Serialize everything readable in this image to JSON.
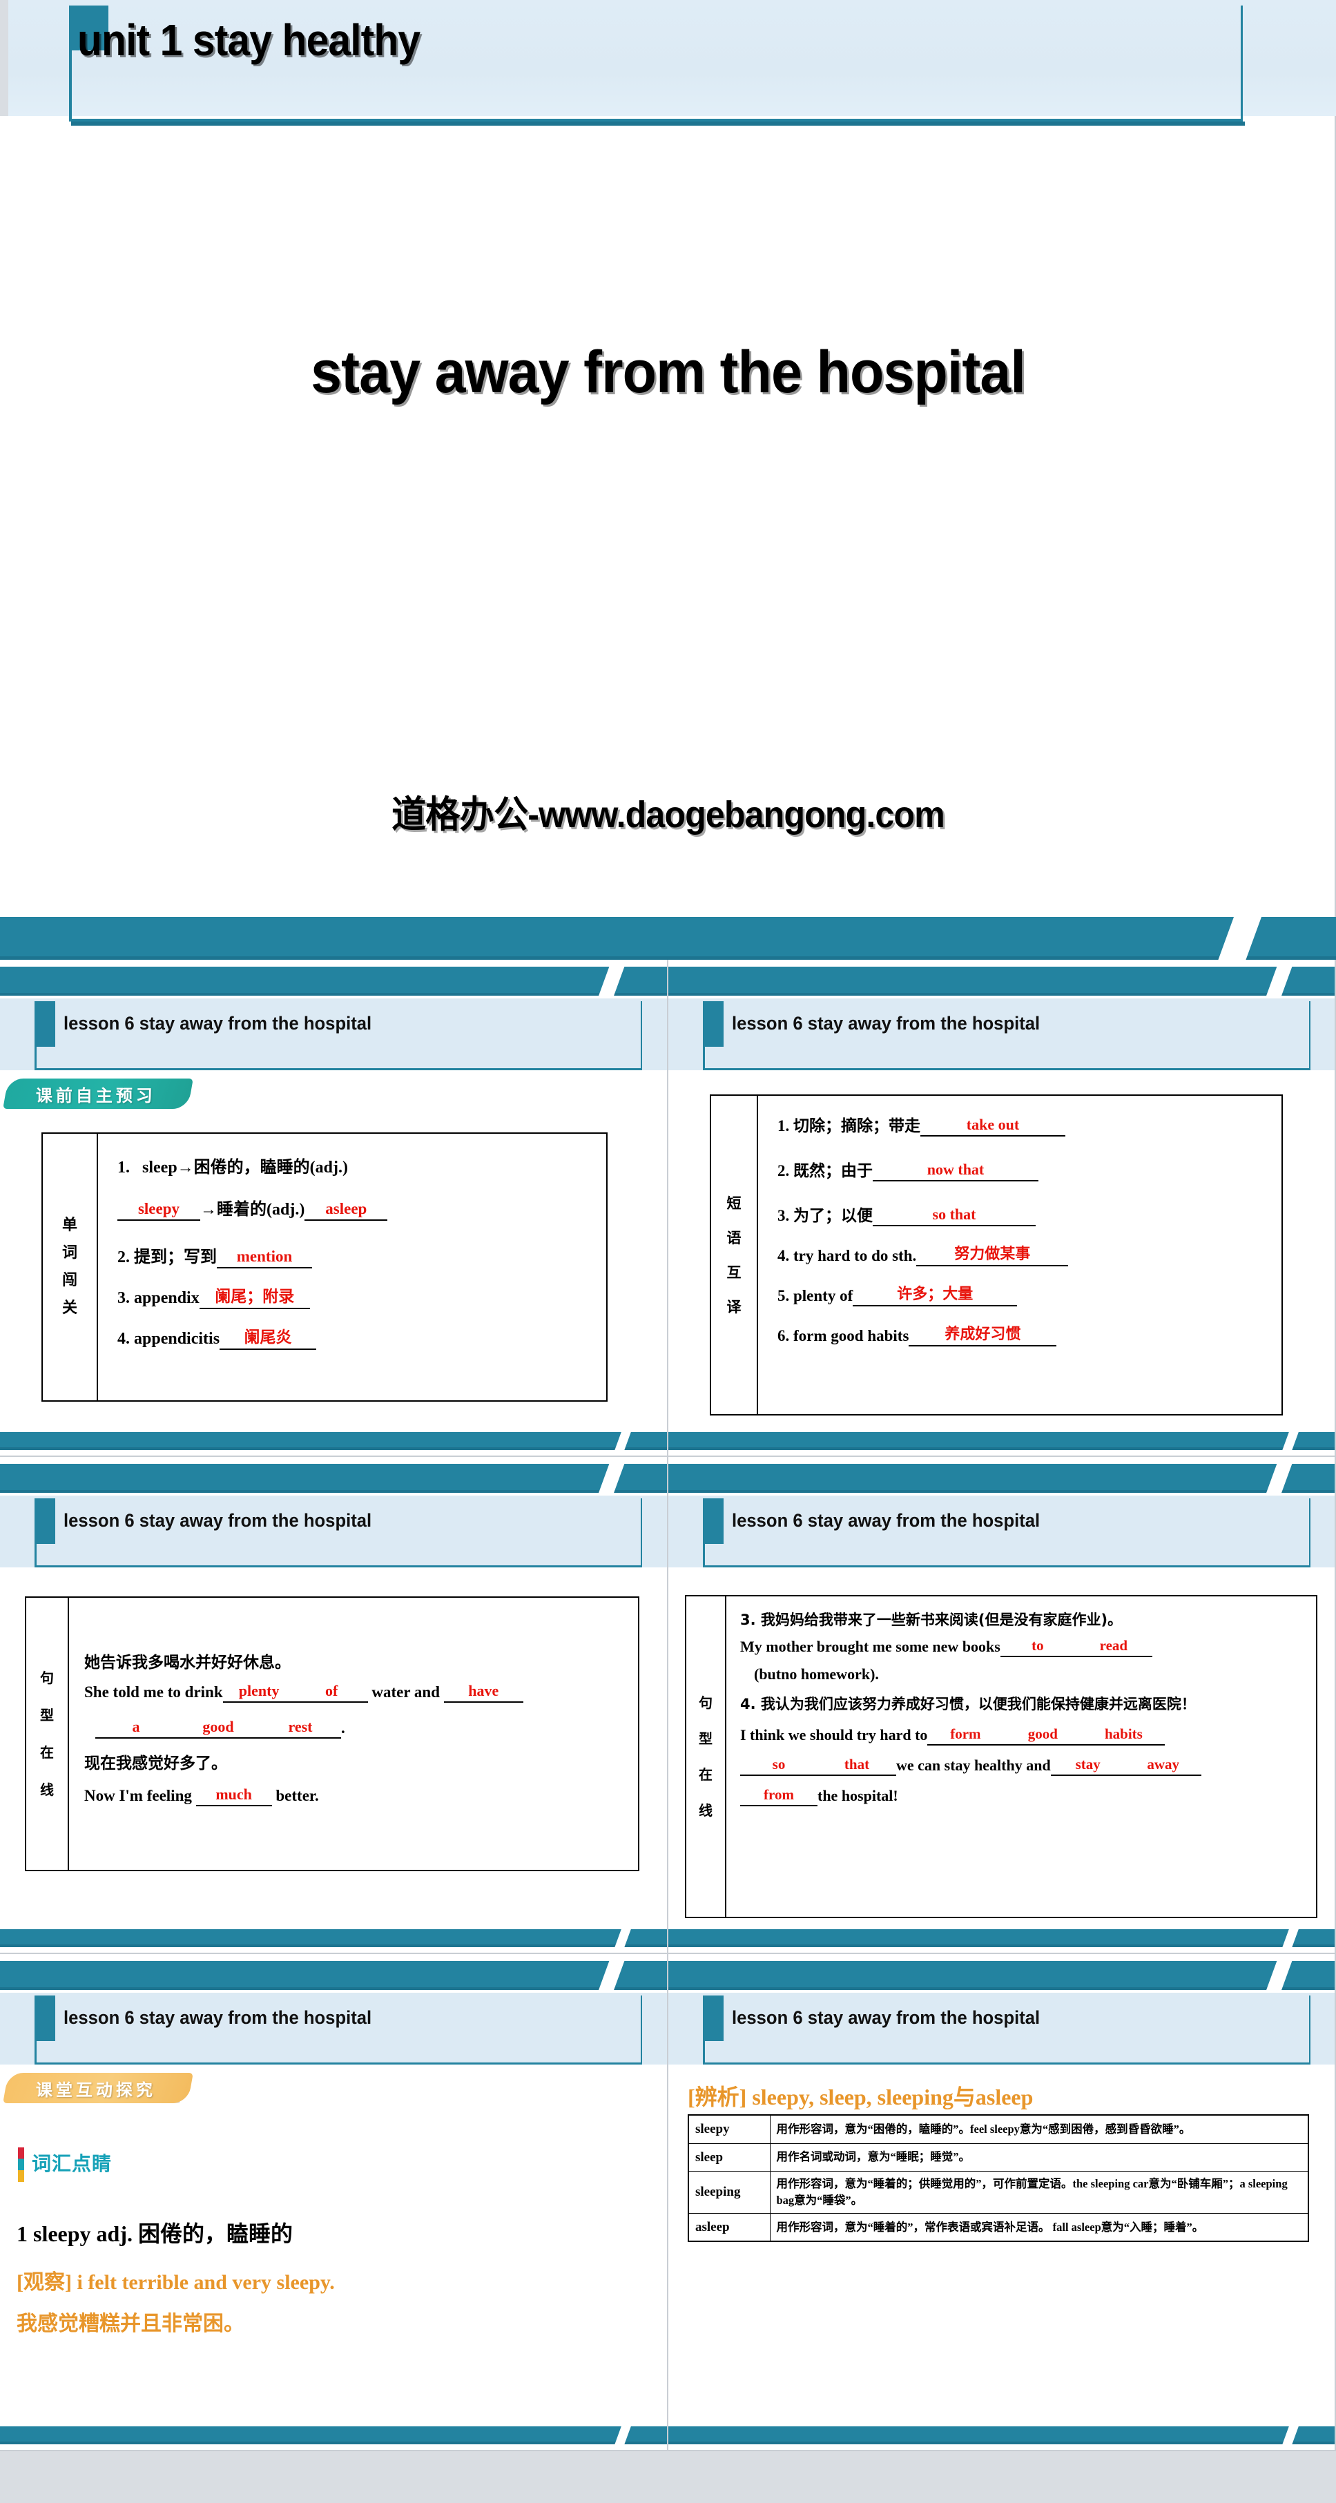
{
  "title_slide": {
    "header_title": "unit 1  stay healthy",
    "main_title": "stay away from the hospital",
    "watermark": "道格办公-www.daogebangong.com"
  },
  "colors": {
    "teal": "#2383a0",
    "teal_dark": "#1d7490",
    "head_band": "#dceaf4",
    "answer_red": "#e8140c",
    "orange": "#e8962b",
    "badge_teal": "#24b3a7",
    "badge_orange": "#f7c268",
    "tag_cyan": "#17a2b8"
  },
  "slides": [
    {
      "id": "slide-words",
      "header": "lesson 6   stay away from the hospital",
      "badge": "课前自主预习",
      "sheet_label": "单词闯关",
      "rows": [
        {
          "num": "1.",
          "pre": "sleep→困倦的，瞌睡的(adj.)",
          "answers": []
        },
        {
          "num": "",
          "pre": "→睡着的(adj.)",
          "answers": [
            "sleepy",
            "asleep"
          ]
        },
        {
          "num": "2.",
          "pre": "提到；写到",
          "answers": [
            "mention"
          ]
        },
        {
          "num": "3.",
          "pre": "appendix",
          "answers": [
            "阑尾；附录"
          ]
        },
        {
          "num": "4.",
          "pre": "appendicitis",
          "answers": [
            "阑尾炎"
          ]
        }
      ]
    },
    {
      "id": "slide-phrases",
      "header": "lesson 6   stay away from the hospital",
      "sheet_label": "短语互译",
      "rows": [
        {
          "num": "1.",
          "pre": "切除；摘除；带走",
          "answer": "take out"
        },
        {
          "num": "2.",
          "pre": "既然；由于",
          "answer": "now that"
        },
        {
          "num": "3.",
          "pre": "为了；以便",
          "answer": "so that"
        },
        {
          "num": "4.",
          "pre": "try hard to do sth.",
          "answer": "努力做某事"
        },
        {
          "num": "5.",
          "pre": "plenty of",
          "answer": "许多；大量"
        },
        {
          "num": "6.",
          "pre": "form good habits",
          "answer": "养成好习惯"
        }
      ]
    },
    {
      "id": "slide-sentences-1",
      "header": "lesson 6   stay away from the hospital",
      "sheet_label": "句型在线",
      "items": [
        {
          "num": "1.",
          "cn": "她告诉我多喝水并好好休息。",
          "en_parts": [
            "She told me to drink ",
            " ",
            " water and ",
            " ",
            " ",
            " ",
            "."
          ],
          "answers": [
            "plenty",
            "of",
            "have",
            "a",
            "good",
            "rest"
          ]
        },
        {
          "num": "2.",
          "cn": "现在我感觉好多了。",
          "en_parts": [
            "Now I'm feeling ",
            " better."
          ],
          "answers": [
            "much"
          ]
        }
      ]
    },
    {
      "id": "slide-sentences-2",
      "header": "lesson 6   stay away from the hospital",
      "sheet_label": "句型在线",
      "items": [
        {
          "num": "3.",
          "cn": "我妈妈给我带来了一些新书来阅读(但是没有家庭作业)。",
          "en_lead": "My mother brought me some new books",
          "en_tail": "(butno homework).",
          "answers": [
            "to",
            "read"
          ]
        },
        {
          "num": "4.",
          "cn": "我认为我们应该努力养成好习惯，以便我们能保持健康并远离医院！",
          "en_lead": "I think we should try hard to",
          "en_mid": "we can stay healthy and",
          "en_tail": "the hospital!",
          "answers": [
            "form",
            "good",
            "habits",
            "so",
            "that",
            "stay",
            "away",
            "from"
          ]
        }
      ]
    },
    {
      "id": "slide-vocab",
      "header": "lesson 6   stay away from the hospital",
      "badge": "课堂互动探究",
      "tag": "词汇点睛",
      "entry": "1   sleepy  adj. 困倦的，瞌睡的",
      "observe": "[观察] i felt terrible and very sleepy.",
      "translation": "我感觉糟糕并且非常困。"
    },
    {
      "id": "slide-compare",
      "header": "lesson 6   stay away from the hospital",
      "compare_title": "[辨析] sleepy, sleep, sleeping与asleep",
      "compare_rows": [
        {
          "key": "sleepy",
          "value": "用作形容词，意为“困倦的，瞌睡的”。feel sleepy意为“感到困倦，感到昏昏欲睡”。"
        },
        {
          "key": "sleep",
          "value": "用作名词或动词，意为“睡眠；睡觉”。"
        },
        {
          "key": "sleeping",
          "value": "用作形容词，意为“睡着的；供睡觉用的”，可作前置定语。the sleeping car意为“卧铺车厢”；a sleeping bag意为“睡袋”。"
        },
        {
          "key": "asleep",
          "value": "用作形容词，意为“睡着的”，常作表语或宾语补足语。 fall asleep意为“入睡；睡着”。"
        }
      ]
    }
  ]
}
